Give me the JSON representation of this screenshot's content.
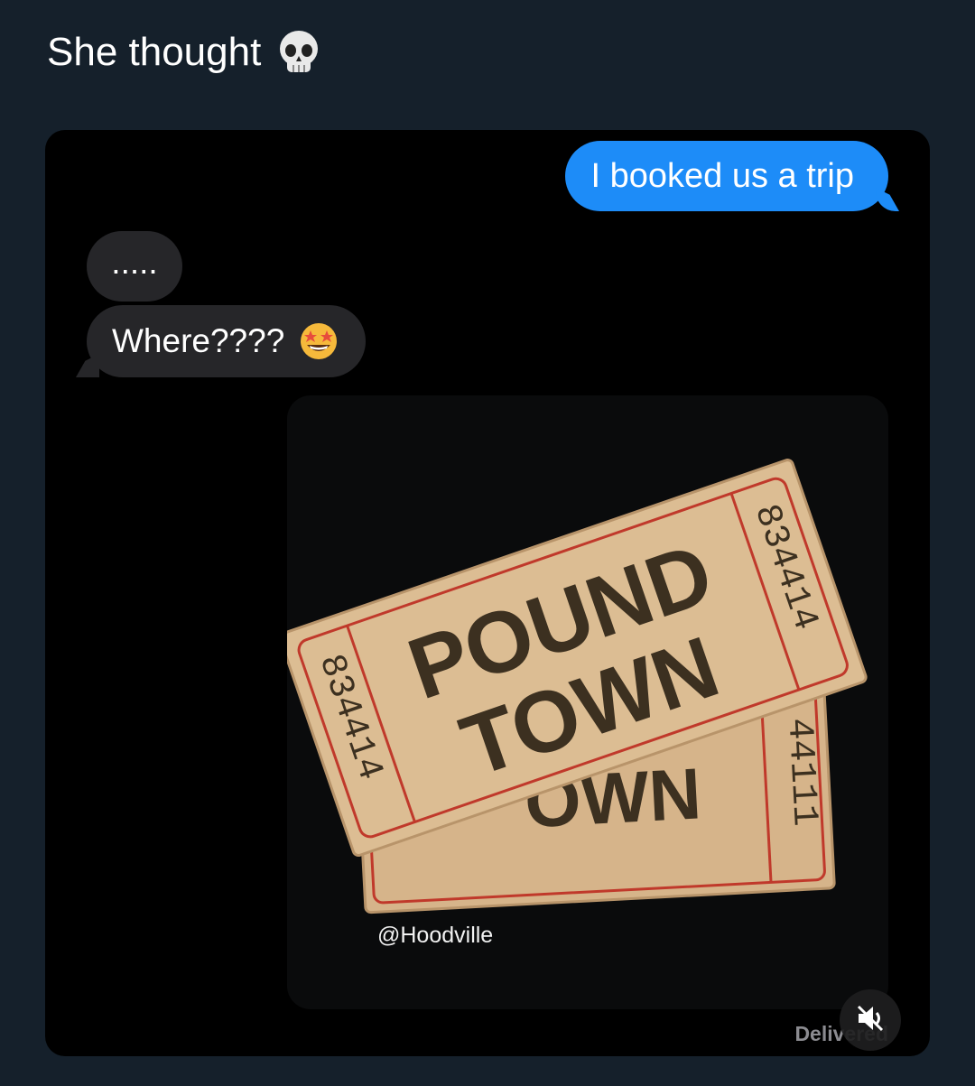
{
  "post": {
    "caption": "She thought",
    "caption_emoji": "skull"
  },
  "chat": {
    "messages": [
      {
        "side": "outgoing",
        "text": "I booked us a trip"
      },
      {
        "side": "incoming",
        "text": "....."
      },
      {
        "side": "incoming",
        "text": "Where????",
        "emoji": "star-struck"
      },
      {
        "side": "outgoing",
        "type": "image",
        "watermark": "@Hoodville"
      }
    ],
    "status": "Delivered"
  },
  "ticket": {
    "front_serial_left": "834414",
    "front_serial_right": "834414",
    "title_line1": "POUND",
    "title_line2": "TOWN",
    "back_serial_right": "44111",
    "back_partial_text": "OWN"
  },
  "colors": {
    "page_bg": "#15202b",
    "chat_bg": "#000000",
    "outgoing_bubble": "#1d8cf8",
    "incoming_bubble": "#262629",
    "ticket": "#d9b98e",
    "ticket_border": "#c0392b"
  },
  "icons": [
    "skull-icon",
    "star-struck-emoji-icon",
    "mute-icon"
  ]
}
